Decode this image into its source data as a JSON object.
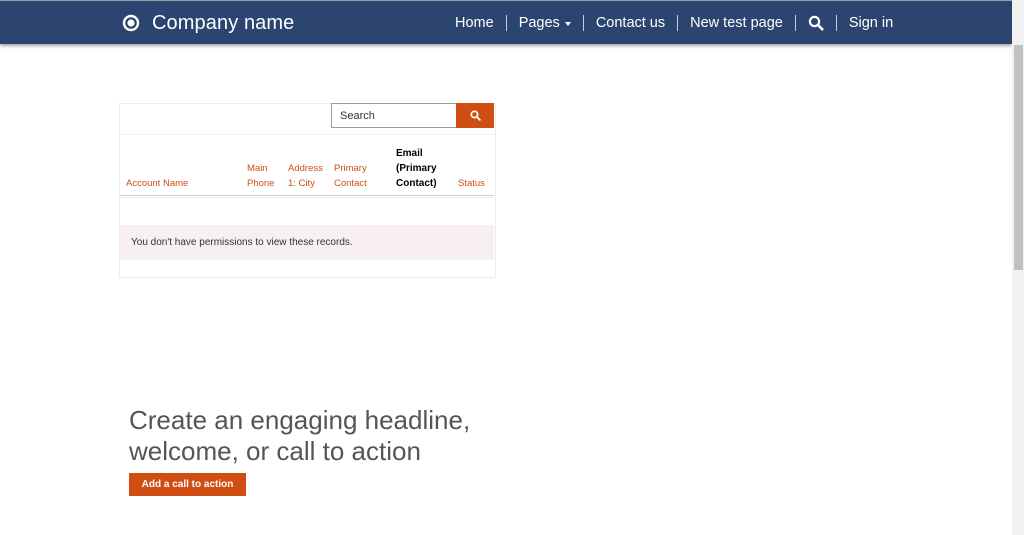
{
  "colors": {
    "navbar": "#2c4570",
    "accent": "#d04e12",
    "alert_bg": "#f8f0f0"
  },
  "navbar": {
    "brand_name": "Company name",
    "logo_icon": "ring-logo-icon",
    "items": [
      {
        "label": "Home"
      },
      {
        "label": "Pages",
        "has_dropdown": true
      },
      {
        "label": "Contact us"
      },
      {
        "label": "New test page"
      },
      {
        "icon": "search-icon"
      },
      {
        "label": "Sign in"
      }
    ]
  },
  "list": {
    "search_placeholder": "Search",
    "search_button_icon": "search-icon",
    "columns": [
      {
        "label": "Account Name"
      },
      {
        "label": "Main Phone"
      },
      {
        "label": "Address 1: City"
      },
      {
        "label": "Primary Contact"
      },
      {
        "label": "Email (Primary Contact)"
      },
      {
        "label": "Status"
      }
    ],
    "message": "You don't have permissions to view these records."
  },
  "hero": {
    "headline": "Create an engaging headline, welcome, or call to action",
    "cta_label": "Add a call to action"
  }
}
